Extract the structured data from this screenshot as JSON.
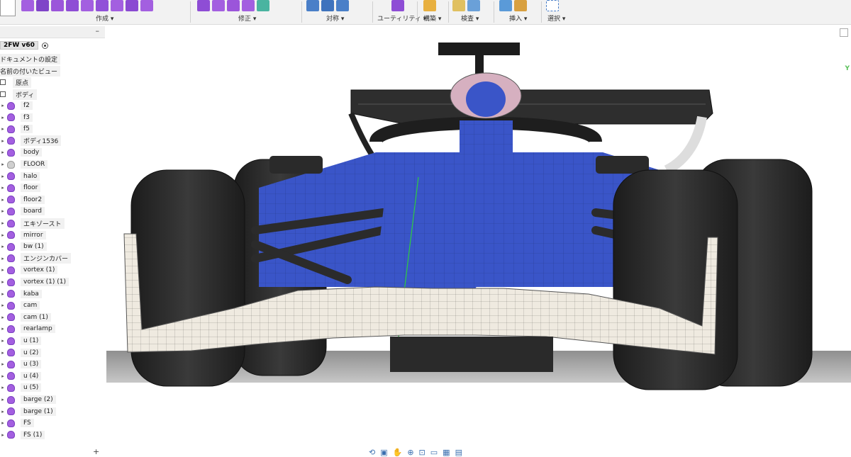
{
  "toolbar": {
    "groups": [
      {
        "label": "作成 ▾"
      },
      {
        "label": "修正 ▾"
      },
      {
        "label": "対称 ▾"
      },
      {
        "label": "ユーティリティ ▾"
      },
      {
        "label": "構築 ▾"
      },
      {
        "label": "検査 ▾"
      },
      {
        "label": "挿入 ▾"
      },
      {
        "label": "選択 ▾"
      }
    ]
  },
  "browser": {
    "collapse_label": "–",
    "root_name": "2FW v60",
    "document_settings": "ドキュメントの設定",
    "named_views": "名前の付いたビュー",
    "origin": "原点",
    "bodies": "ボディ",
    "items": [
      "f2",
      "f3",
      "f5",
      "ボディ1536",
      "body",
      "FLOOR",
      "halo",
      "floor",
      "floor2",
      "board",
      "エキゾースト",
      "mirror",
      "bw (1)",
      "エンジンカバー",
      "vortex (1)",
      "vortex (1) (1)",
      "kaba",
      "cam",
      "cam (1)",
      "rearlamp",
      "u (1)",
      "u (2)",
      "u (3)",
      "u (4)",
      "u (5)",
      "barge (2)",
      "barge (1)",
      "FS",
      "FS (1)"
    ],
    "add_label": "+"
  },
  "viewcube": {
    "axis_label": "Y"
  },
  "colors": {
    "body_icon": "#a35fe0",
    "car_blue": "#3a55c8",
    "wing_white": "#efeae0",
    "tire": "#2a2a2a"
  },
  "nav_icons": [
    "orbit-icon",
    "look-at-icon",
    "pan-icon",
    "zoom-icon",
    "fit-icon",
    "display-icon",
    "grid-icon",
    "viewports-icon"
  ]
}
